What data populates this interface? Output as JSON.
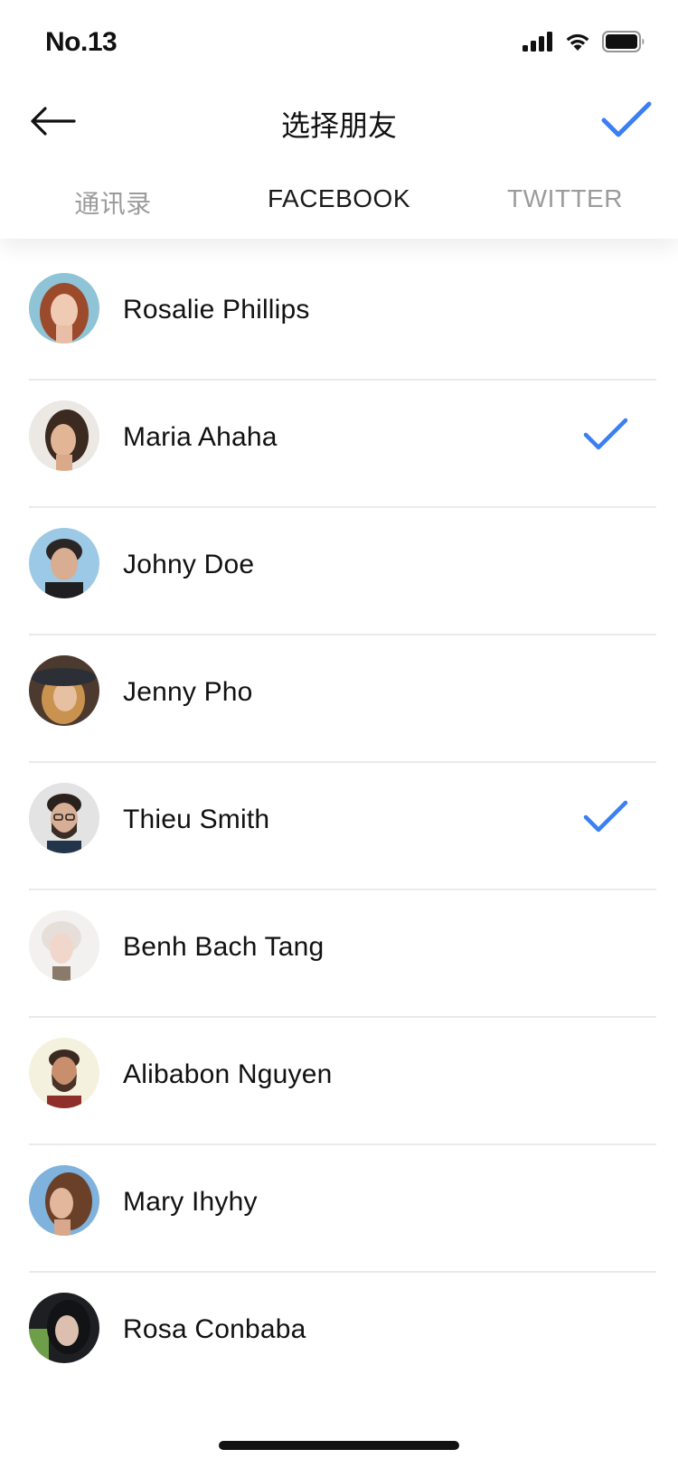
{
  "status_bar": {
    "carrier": "No.13",
    "icons": [
      "signal-icon",
      "wifi-icon",
      "battery-icon"
    ]
  },
  "nav": {
    "back_icon": "arrow-left-icon",
    "title": "选择朋友",
    "confirm_icon": "checkmark-icon"
  },
  "tabs": [
    {
      "label": "通讯录",
      "active": false
    },
    {
      "label": "FACEBOOK",
      "active": true
    },
    {
      "label": "TWITTER",
      "active": false
    }
  ],
  "colors": {
    "accent": "#3b7ff2",
    "inactive_tab": "#9b9b9b",
    "divider": "#eaeaea"
  },
  "friends": [
    {
      "name": "Rosalie Phillips",
      "selected": false
    },
    {
      "name": "Maria Ahaha",
      "selected": true
    },
    {
      "name": "Johny Doe",
      "selected": false
    },
    {
      "name": "Jenny Pho",
      "selected": false
    },
    {
      "name": "Thieu Smith",
      "selected": true
    },
    {
      "name": "Benh Bach Tang",
      "selected": false
    },
    {
      "name": "Alibabon Nguyen",
      "selected": false
    },
    {
      "name": "Mary Ihyhy",
      "selected": false
    },
    {
      "name": "Rosa Conbaba",
      "selected": false
    }
  ]
}
